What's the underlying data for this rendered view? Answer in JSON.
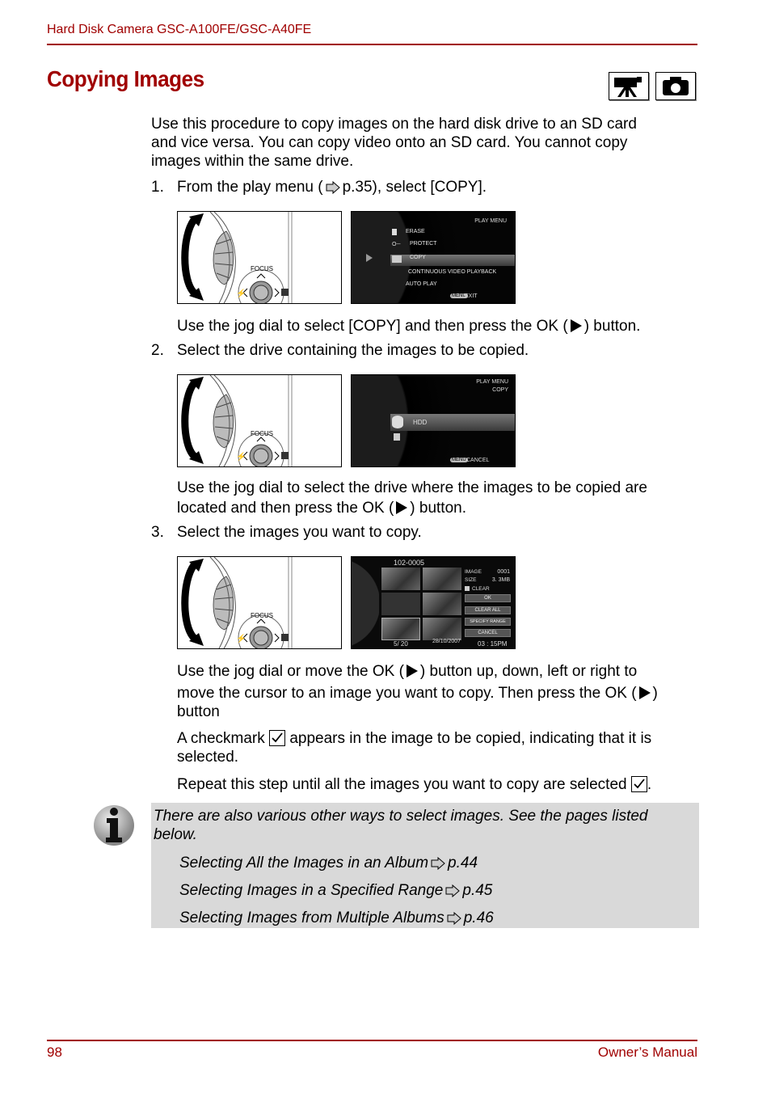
{
  "header": {
    "title": "Hard Disk Camera GSC-A100FE/GSC-A40FE"
  },
  "page_title": "Copying Images",
  "mode_icons": [
    "video-camera-icon",
    "still-camera-icon"
  ],
  "intro": {
    "line1": "Use this procedure to copy images on the hard disk drive to an SD card",
    "line2": "and vice versa. You can copy video onto an SD card. You cannot copy",
    "line3": "images within the same drive."
  },
  "steps": [
    {
      "number": "1.",
      "text_before_ref": "From the play menu (",
      "ref": "p.35), select [COPY].",
      "detail_before": "Use the jog dial to select [COPY] and then press the OK (",
      "detail_after": ") button."
    },
    {
      "number": "2.",
      "text": "Select the drive containing the images to be copied.",
      "detail_line1": "Use the jog dial to select the drive where the images to be copied are",
      "detail_line2_before": "located and then press the OK (",
      "detail_line2_after": ") button."
    },
    {
      "number": "3.",
      "text": "Select the images you want to copy.",
      "detail1_line1_before": "Use the jog dial or move the OK (",
      "detail1_line1_after": ") button up, down, left or right to",
      "detail1_line2_before": "move the cursor to an image you want to copy. Then press the OK (",
      "detail1_line2_after": ")",
      "detail1_line3": "button",
      "detail2_line1_before": "A checkmark",
      "detail2_line1_after": "appears in the image to be copied, indicating that it is",
      "detail2_line2": "selected.",
      "detail3_before": "Repeat this step until all the images you want to copy are selected",
      "detail3_after": "."
    }
  ],
  "illustration": {
    "focus_label": "FOCUS"
  },
  "screen1": {
    "title": "PLAY MENU",
    "items": [
      "ERASE",
      "PROTECT",
      "COPY",
      "CONTINUOUS VIDEO PLAYBACK",
      "AUTO PLAY"
    ],
    "selected": "COPY",
    "menu_badge": "MENU",
    "footer": "EXIT"
  },
  "screen2": {
    "title": "PLAY MENU",
    "subtitle": "COPY",
    "drive": "HDD",
    "menu_badge": "MENU",
    "footer": "CANCEL"
  },
  "screen3": {
    "folder": "102-0005",
    "image_label": "IMAGE",
    "image_value": "0001",
    "size_label": "SIZE",
    "size_value": "3. 3MB",
    "clear_label": "CLEAR",
    "buttons": [
      "OK",
      "CLEAR ALL",
      "SPECIFY RANGE",
      "CANCEL"
    ],
    "counter": "5/ 20",
    "date": "28/10/2007",
    "time": "03 : 15PM"
  },
  "note": {
    "line1": "There are also various other ways to select images. See the pages listed",
    "line2": "below.",
    "links": [
      {
        "text": "Selecting All the Images in an Album",
        "page": "p.44"
      },
      {
        "text": "Selecting Images in a Specified Range",
        "page": "p.45"
      },
      {
        "text": "Selecting Images from Multiple Albums",
        "page": "p.46"
      }
    ]
  },
  "footer": {
    "page_number": "98",
    "manual": "Owner’s Manual"
  },
  "colors": {
    "accent": "#a00000",
    "note_bg": "#d9d9d9"
  }
}
